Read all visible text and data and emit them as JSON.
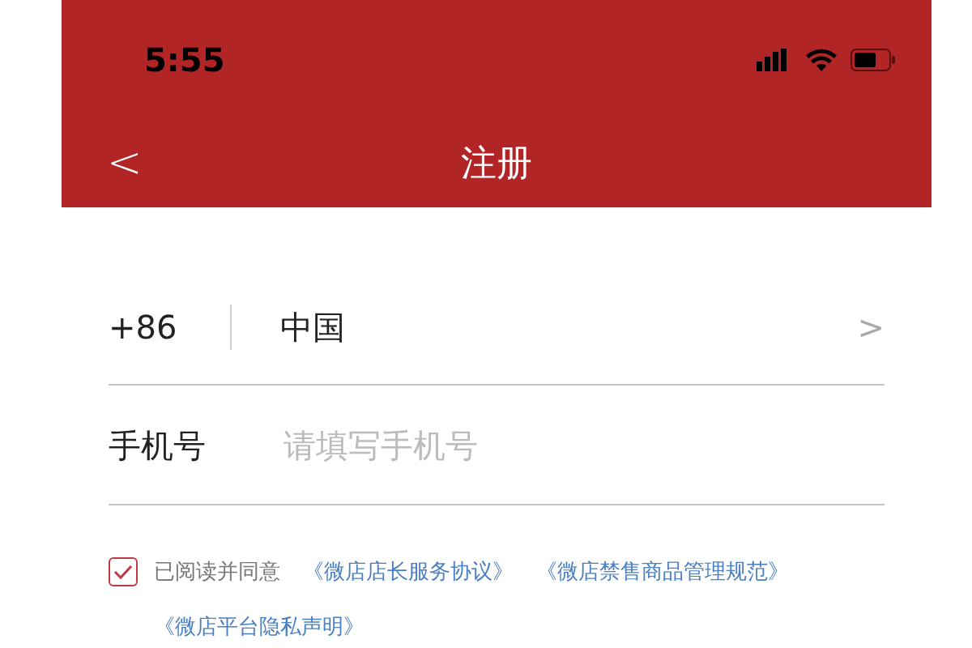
{
  "status_bar": {
    "time": "5:55"
  },
  "nav": {
    "back": "<",
    "title": "注册"
  },
  "country_row": {
    "code": "+86",
    "country": "中国",
    "chevron": ">"
  },
  "phone_row": {
    "label": "手机号",
    "placeholder": "请填写手机号"
  },
  "agreement": {
    "checked": true,
    "text": "已阅读并同意",
    "links": [
      "《微店店长服务协议》",
      "《微店禁售商品管理规范》",
      "《微店平台隐私声明》"
    ]
  }
}
